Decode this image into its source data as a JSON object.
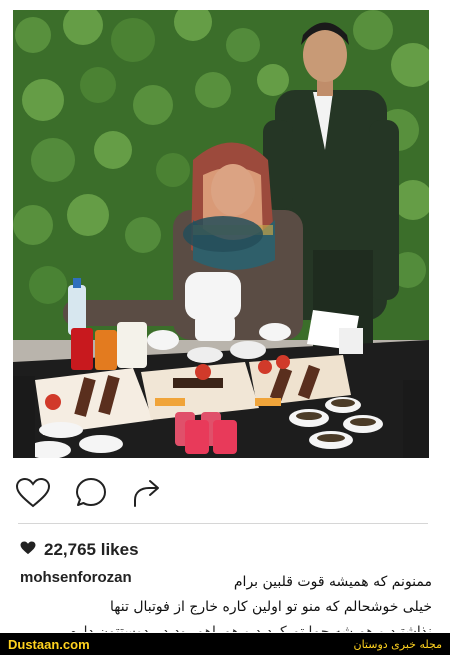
{
  "post": {
    "likes": "22,765 likes",
    "username": "mohsenforozan",
    "caption_line1": "ممنونم که همیشه قوت قلبین برام",
    "caption_line2": "خیلی خوشحالم که منو تو اولین کاره خارج از فوتبال تنها",
    "caption_line3": "نذاشتید و همیشه حمایتم کردید و همراهم بودید . دوستتون دارم"
  },
  "icons": {
    "like": "heart-outline-icon",
    "comment": "comment-bubble-icon",
    "share": "share-arrow-icon",
    "likes_heart": "heart-filled-icon"
  },
  "watermark": {
    "site": "Dustaan.com",
    "tagline": "مجله خبری دوستان"
  },
  "colors": {
    "accent": "#ffd21f",
    "hedge": "#3f7a2a",
    "suit": "#2a3d2a"
  }
}
